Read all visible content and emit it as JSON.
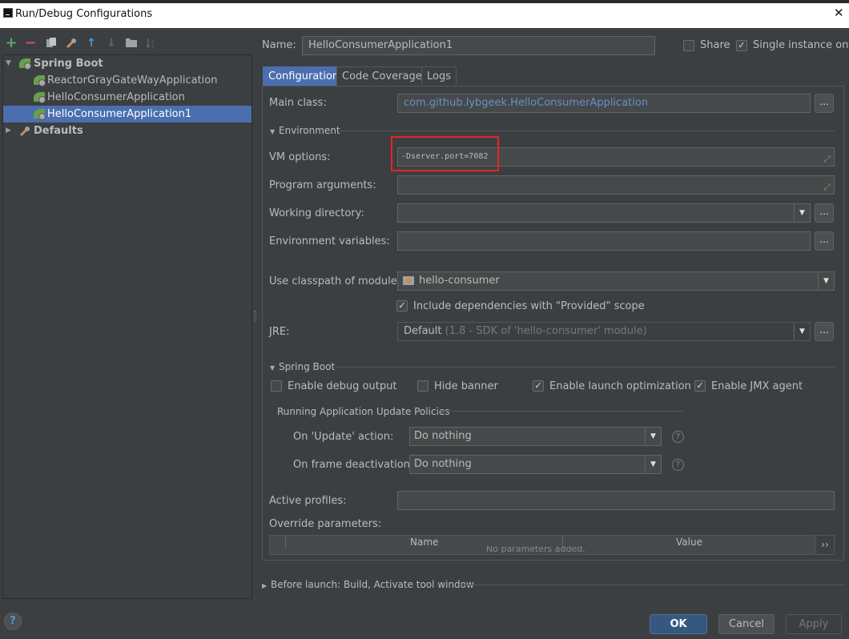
{
  "window": {
    "title": "Run/Debug Configurations"
  },
  "toolbar": {
    "add": "+",
    "remove": "−",
    "copy": "copy",
    "edit": "wrench",
    "move_up": "↑",
    "move_down": "↓",
    "folder": "folder",
    "sort": "sort"
  },
  "tree": {
    "group_label": "Spring Boot",
    "items": [
      {
        "label": "ReactorGrayGateWayApplication"
      },
      {
        "label": "HelloConsumerApplication"
      },
      {
        "label": "HelloConsumerApplication1"
      }
    ],
    "defaults_label": "Defaults"
  },
  "header": {
    "name_label": "Name:",
    "name_value": "HelloConsumerApplication1",
    "share_label": "Share",
    "share_checked": false,
    "single_instance_label": "Single instance only",
    "single_instance_checked": true
  },
  "tabs": [
    {
      "label": "Configuration",
      "active": true
    },
    {
      "label": "Code Coverage",
      "active": false
    },
    {
      "label": "Logs",
      "active": false
    }
  ],
  "config": {
    "main_class_label": "Main class:",
    "main_class_value": "com.github.lybgeek.HelloConsumerApplication",
    "environment_section": "Environment",
    "vm_options_label": "VM options:",
    "vm_options_value": "-Dserver.port=7082",
    "program_args_label": "Program arguments:",
    "program_args_value": "",
    "working_dir_label": "Working directory:",
    "working_dir_value": "",
    "env_vars_label": "Environment variables:",
    "env_vars_value": "",
    "classpath_label": "Use classpath of module:",
    "classpath_value": "hello-consumer",
    "include_deps_label": "Include dependencies with \"Provided\" scope",
    "include_deps_checked": true,
    "jre_label": "JRE:",
    "jre_value": "Default",
    "jre_detail": "(1.8 - SDK of 'hello-consumer' module)",
    "spring_boot_section": "Spring Boot",
    "debug_output_label": "Enable debug output",
    "debug_output_checked": false,
    "hide_banner_label": "Hide banner",
    "hide_banner_checked": false,
    "launch_opt_label": "Enable launch optimization",
    "launch_opt_checked": true,
    "jmx_label": "Enable JMX agent",
    "jmx_checked": true,
    "policies_section": "Running Application Update Policies",
    "on_update_label": "On 'Update' action:",
    "on_update_value": "Do nothing",
    "on_frame_label": "On frame deactivation:",
    "on_frame_value": "Do nothing",
    "active_profiles_label": "Active profiles:",
    "active_profiles_value": "",
    "override_params_label": "Override parameters:",
    "table_columns": [
      "Name",
      "Value"
    ],
    "table_empty_text": "No parameters added."
  },
  "before_launch_label": "Before launch: Build, Activate tool window",
  "buttons": {
    "ok": "OK",
    "cancel": "Cancel",
    "apply": "Apply"
  },
  "colors": {
    "accent": "#4b6eaf",
    "highlight": "#e8222a",
    "background": "#3c3f41"
  }
}
